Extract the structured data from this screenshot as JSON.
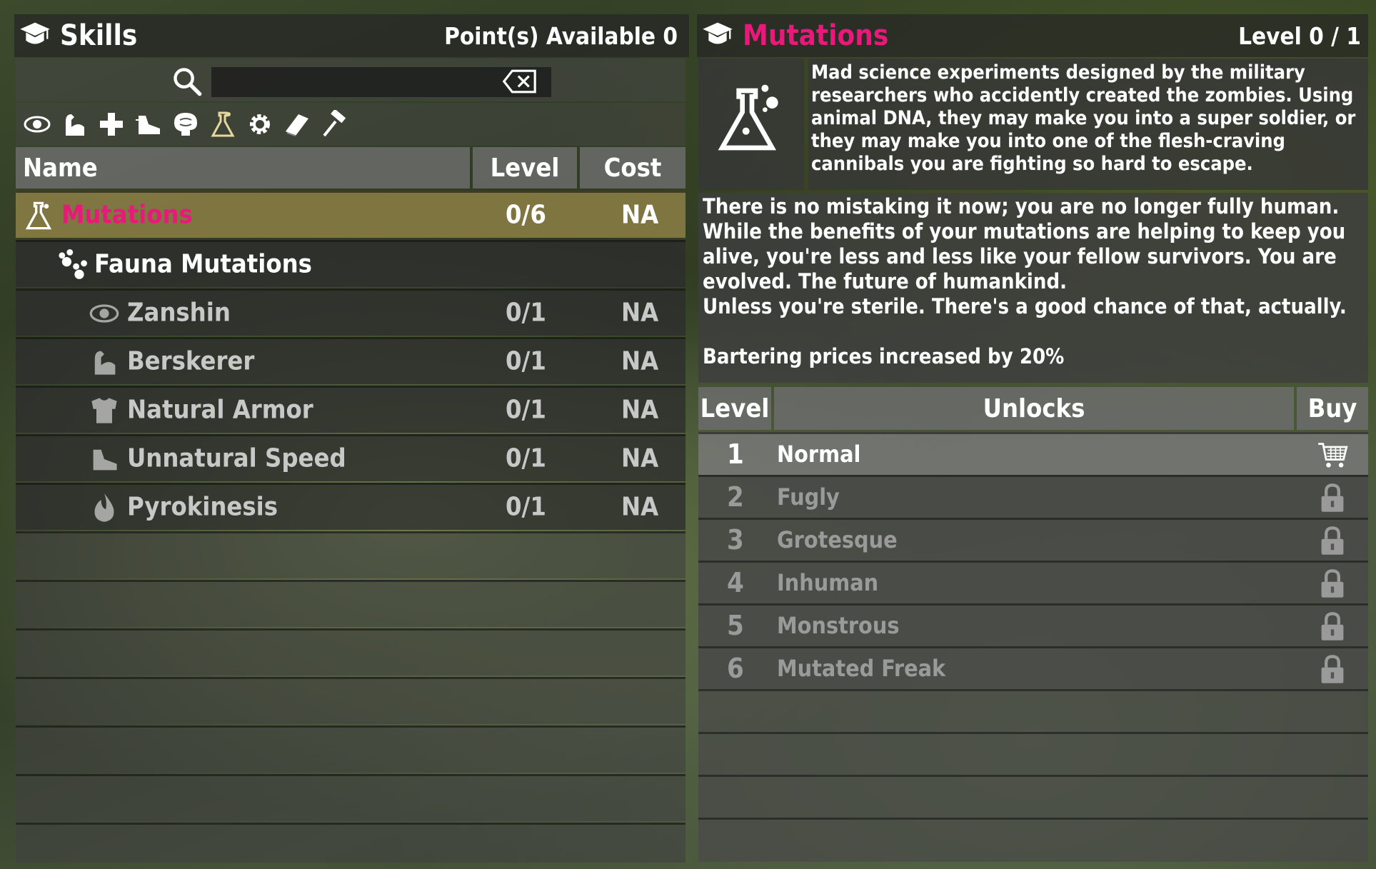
{
  "skills_panel": {
    "title": "Skills",
    "points_label": "Point(s) Available 0",
    "search": {
      "placeholder": ""
    },
    "category_icons": [
      "eye-icon",
      "flexed-arm-icon",
      "plus-icon",
      "running-shoe-icon",
      "brain-icon",
      "flask-icon",
      "gear-icon",
      "book-icon",
      "hammer-icon"
    ],
    "columns": {
      "name": "Name",
      "level": "Level",
      "cost": "Cost"
    },
    "rows": [
      {
        "name": "Mutations",
        "level": "0/6",
        "cost": "NA",
        "icon": "flask-icon"
      },
      {
        "name": "Fauna Mutations",
        "level": "",
        "cost": "",
        "icon": "paw-icon"
      },
      {
        "name": "Zanshin",
        "level": "0/1",
        "cost": "NA",
        "icon": "eye-icon"
      },
      {
        "name": "Berskerer",
        "level": "0/1",
        "cost": "NA",
        "icon": "flexed-arm-icon"
      },
      {
        "name": "Natural Armor",
        "level": "0/1",
        "cost": "NA",
        "icon": "armor-icon"
      },
      {
        "name": "Unnatural Speed",
        "level": "0/1",
        "cost": "NA",
        "icon": "running-shoe-icon"
      },
      {
        "name": "Pyrokinesis",
        "level": "0/1",
        "cost": "NA",
        "icon": "flame-icon"
      }
    ]
  },
  "detail_panel": {
    "title": "Mutations",
    "level_label": "Level 0 / 1",
    "short_description": "Mad science experiments designed by the military researchers who accidently created the zombies. Using animal DNA, they may make you into a super soldier, or they may make you into one of the flesh-craving cannibals you are fighting so hard to escape.",
    "long_description_1": "There is no mistaking it now; you are no longer fully human.  While the benefits of your mutations are helping to keep you alive, you're less and less like your fellow survivors.  You are evolved.  The future of humankind.",
    "long_description_2": "Unless you're sterile.  There's a good chance of that, actually.",
    "long_description_3": "Bartering prices increased by 20%",
    "columns": {
      "level": "Level",
      "unlocks": "Unlocks",
      "buy": "Buy"
    },
    "unlocks": [
      {
        "level": "1",
        "name": "Normal",
        "buy_icon": "cart-icon"
      },
      {
        "level": "2",
        "name": "Fugly",
        "buy_icon": "lock-icon"
      },
      {
        "level": "3",
        "name": "Grotesque",
        "buy_icon": "lock-icon"
      },
      {
        "level": "4",
        "name": "Inhuman",
        "buy_icon": "lock-icon"
      },
      {
        "level": "5",
        "name": "Monstrous",
        "buy_icon": "lock-icon"
      },
      {
        "level": "6",
        "name": "Mutated Freak",
        "buy_icon": "lock-icon"
      }
    ]
  },
  "colors": {
    "accent": "#e8197a",
    "selected_row": "#8a7d45"
  }
}
